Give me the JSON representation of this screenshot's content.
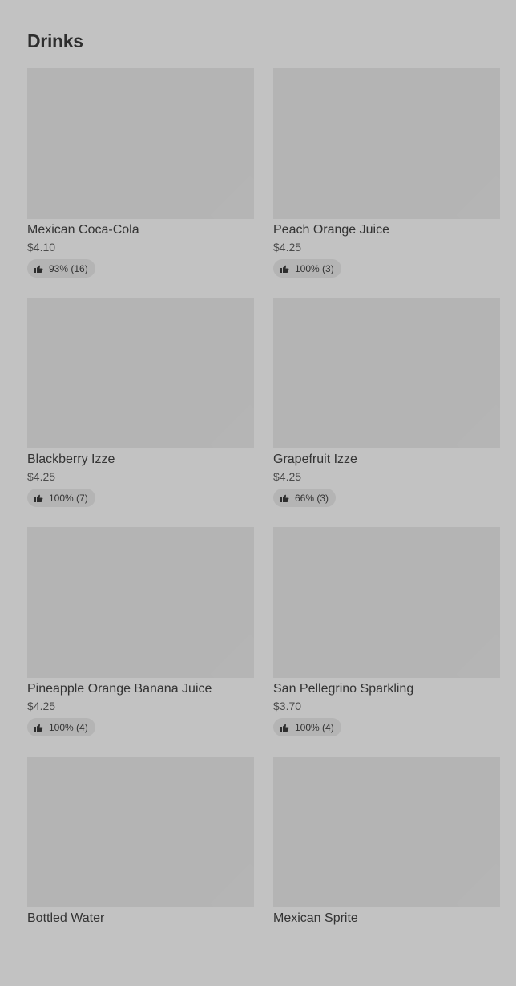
{
  "section": {
    "title": "Drinks"
  },
  "items": [
    {
      "name": "Mexican Coca-Cola",
      "price": "$4.10",
      "rating": "93% (16)"
    },
    {
      "name": "Peach Orange Juice",
      "price": "$4.25",
      "rating": "100% (3)"
    },
    {
      "name": "Blackberry Izze",
      "price": "$4.25",
      "rating": "100% (7)"
    },
    {
      "name": "Grapefruit Izze",
      "price": "$4.25",
      "rating": "66% (3)"
    },
    {
      "name": "Pineapple Orange Banana Juice",
      "price": "$4.25",
      "rating": "100% (4)"
    },
    {
      "name": "San Pellegrino Sparkling",
      "price": "$3.70",
      "rating": "100% (4)"
    },
    {
      "name": "Bottled Water",
      "price": "",
      "rating": ""
    },
    {
      "name": "Mexican Sprite",
      "price": "",
      "rating": ""
    }
  ],
  "icons": {
    "rating": "thumbs-up-icon"
  },
  "colors": {
    "background": "#c2c2c2",
    "image_placeholder": "#b4b4b4",
    "badge": "#b4b4b4",
    "text": "#2e2e2e"
  }
}
